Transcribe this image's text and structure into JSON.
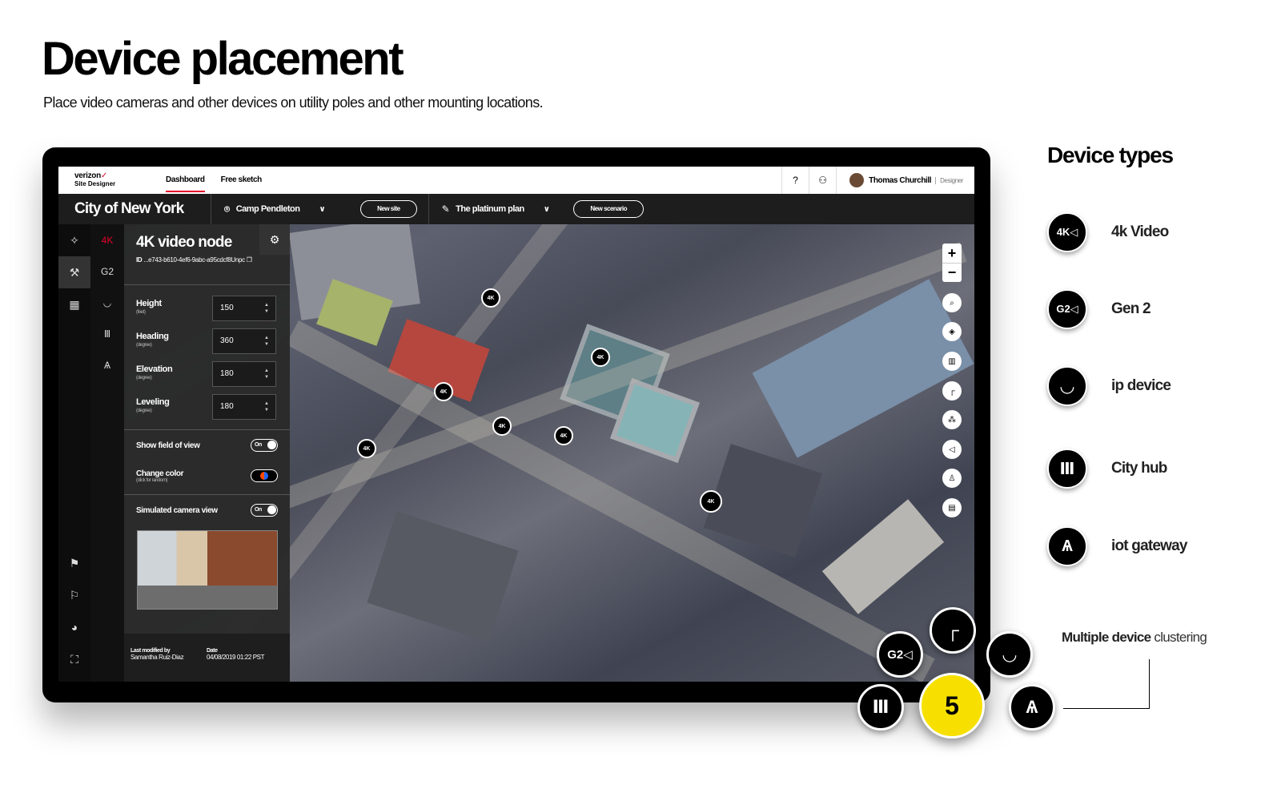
{
  "page": {
    "title": "Device placement",
    "subtitle": "Place video cameras and other devices on utility poles and other mounting locations."
  },
  "app": {
    "logo_line1": "verizon",
    "logo_check": "✓",
    "logo_line2": "Site Designer",
    "tabs": [
      {
        "label": "Dashboard",
        "active": true
      },
      {
        "label": "Free sketch",
        "active": false
      }
    ],
    "help_icon": "help-icon",
    "team_icon": "team-icon",
    "user_name": "Thomas Churchill",
    "user_role": "Designer"
  },
  "subnav": {
    "city": "City of New York",
    "site": "Camp Pendleton",
    "new_site": "New site",
    "plan": "The platinum plan",
    "new_scenario": "New scenario"
  },
  "panel": {
    "title": "4K video node",
    "id_label": "ID",
    "id_value": "...e743-b610-4ef6-9abc-a95cdcf8Unpc",
    "fields": [
      {
        "label": "Height",
        "unit": "(feet)",
        "value": "150"
      },
      {
        "label": "Heading",
        "unit": "(degree)",
        "value": "360"
      },
      {
        "label": "Elevation",
        "unit": "(degree)",
        "value": "180"
      },
      {
        "label": "Leveling",
        "unit": "(degree)",
        "value": "180"
      }
    ],
    "show_fov_label": "Show field of view",
    "show_fov_state": "On",
    "change_color_label": "Change color",
    "change_color_hint": "(click for random)",
    "sim_view_label": "Simulated camera view",
    "sim_view_state": "On",
    "modified_by_label": "Last modified by",
    "modified_by": "Samantha Ruiz-Diaz",
    "date_label": "Date",
    "date": "04/08/2019  01:22 PST"
  },
  "map": {
    "marker_icon": "4k-camera-icon",
    "controls": [
      "zoom-in-icon",
      "zoom-out-icon",
      "search-icon",
      "layers-icon",
      "map-icon",
      "pole-icon",
      "cluster-icon",
      "share-icon",
      "person-icon",
      "clipboard-icon"
    ]
  },
  "device_types": {
    "title": "Device types",
    "items": [
      {
        "label": "4k Video",
        "icon": "4k-video-icon",
        "glyph": "4K◁"
      },
      {
        "label": "Gen 2",
        "icon": "gen2-icon",
        "glyph": "G2◁"
      },
      {
        "label": "ip device",
        "icon": "ip-device-icon",
        "glyph": "◡"
      },
      {
        "label": "City hub",
        "icon": "city-hub-icon",
        "glyph": "Ⅲ"
      },
      {
        "label": "iot gateway",
        "icon": "iot-gateway-icon",
        "glyph": "Ѧ"
      }
    ]
  },
  "clustering": {
    "label_bold": "Multiple device",
    "label_rest": " clustering",
    "count": "5"
  }
}
